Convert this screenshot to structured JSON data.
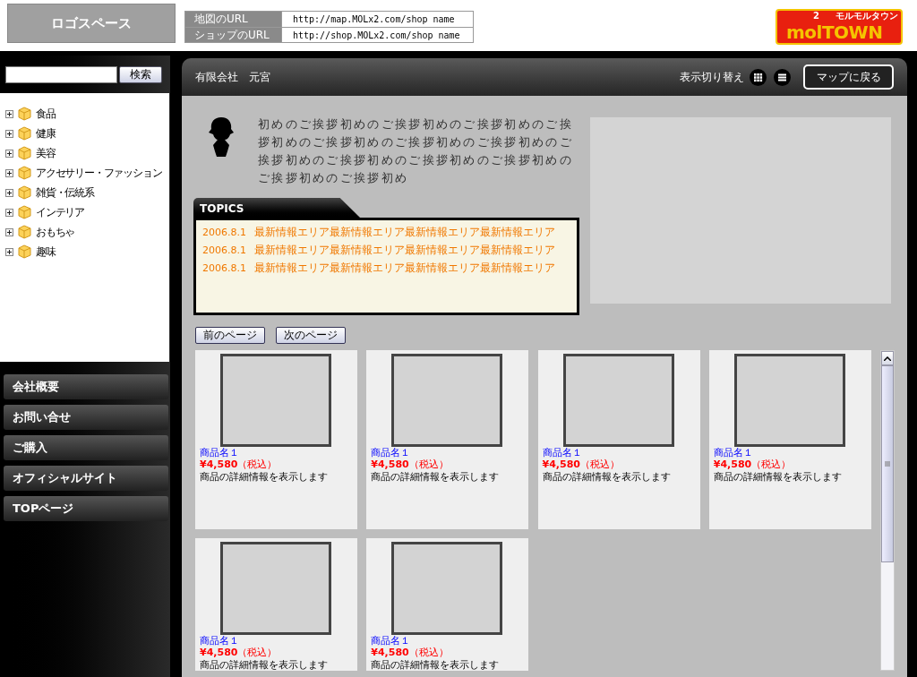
{
  "header": {
    "logo_space": "ロゴスペース",
    "urls": [
      {
        "label": "地図のURL",
        "value": "http://map.MOLx2.com/shop name"
      },
      {
        "label": "ショップのURL",
        "value": "http://shop.MOLx2.com/shop name"
      }
    ],
    "brand": {
      "main": "molTOWN",
      "sup": "2",
      "tagline": "モルモルタウン"
    }
  },
  "sidebar": {
    "search": {
      "button": "検索"
    },
    "categories": [
      {
        "label": "食品",
        "expanded": false
      },
      {
        "label": "健康",
        "expanded": false
      },
      {
        "label": "美容",
        "expanded": false
      },
      {
        "label": "アクセサリー・ファッション",
        "expanded": false
      },
      {
        "label": "雑貨・伝統系",
        "expanded": false
      },
      {
        "label": "インテリア",
        "expanded": false
      },
      {
        "label": "おもちゃ",
        "expanded": false
      },
      {
        "label": "趣味",
        "expanded": false
      }
    ],
    "menu": [
      "会社概要",
      "お問い合せ",
      "ご購入",
      "オフィシャルサイト",
      "TOPページ"
    ]
  },
  "main": {
    "shop_name": "有限会社　元宮",
    "view_switch": "表示切り替え",
    "back_button": "マップに戻る",
    "greeting": "初めのご挨拶初めのご挨拶初めのご挨拶初めのご挨拶初めのご挨拶初めのご挨拶初めのご挨拶初めのご挨拶初めのご挨拶初めのご挨拶初めのご挨拶初めのご挨拶初めのご挨拶初め",
    "topics": {
      "title": "TOPICS",
      "items": [
        {
          "date": "2006.8.1",
          "text": "最新情報エリア最新情報エリア最新情報エリア最新情報エリア"
        },
        {
          "date": "2006.8.1",
          "text": "最新情報エリア最新情報エリア最新情報エリア最新情報エリア"
        },
        {
          "date": "2006.8.1",
          "text": "最新情報エリア最新情報エリア最新情報エリア最新情報エリア"
        }
      ]
    },
    "pager": [
      "前のページ",
      "次のページ"
    ],
    "products": [
      {
        "name": "商品名１",
        "price": "¥4,580",
        "tax": "（税込）",
        "description": "商品の詳細情報を表示します"
      },
      {
        "name": "商品名１",
        "price": "¥4,580",
        "tax": "（税込）",
        "description": "商品の詳細情報を表示します"
      },
      {
        "name": "商品名１",
        "price": "¥4,580",
        "tax": "（税込）",
        "description": "商品の詳細情報を表示します"
      },
      {
        "name": "商品名１",
        "price": "¥4,580",
        "tax": "（税込）",
        "description": "商品の詳細情報を表示します"
      },
      {
        "name": "商品名１",
        "price": "¥4,580",
        "tax": "（税込）",
        "description": "商品の詳細情報を表示します"
      },
      {
        "name": "商品名１",
        "price": "¥4,580",
        "tax": "（税込）",
        "description": "商品の詳細情報を表示します"
      }
    ]
  }
}
